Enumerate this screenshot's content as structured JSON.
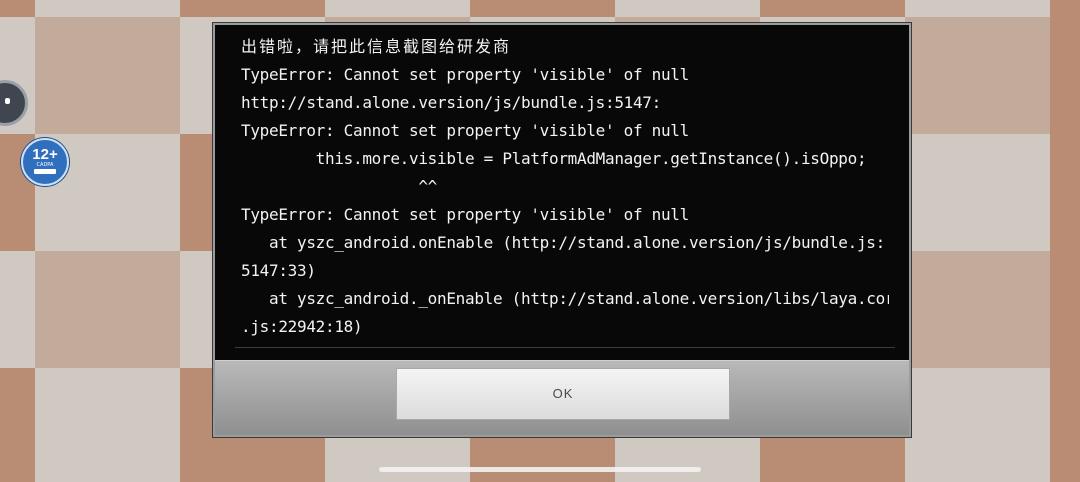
{
  "background": {
    "colors": {
      "dark": "#b98d74",
      "light": "#cfc9c2"
    },
    "age_badge": {
      "label": "12+",
      "sub": "CADPA"
    }
  },
  "dialog": {
    "lines": [
      "出错啦，请把此信息截图给研发商",
      "TypeError: Cannot set property 'visible' of null",
      "http://stand.alone.version/js/bundle.js:5147:",
      "TypeError: Cannot set property 'visible' of null",
      "        this.more.visible = PlatformAdManager.getInstance().isOppo;",
      "                   ^^",
      "TypeError: Cannot set property 'visible' of null",
      "   at yszc_android.onEnable (http://stand.alone.version/js/bundle.js:",
      "5147:33)",
      "   at yszc_android._onEnable (http://stand.alone.version/libs/laya.core",
      ".js:22942:18)"
    ],
    "ok_label": "OK"
  }
}
